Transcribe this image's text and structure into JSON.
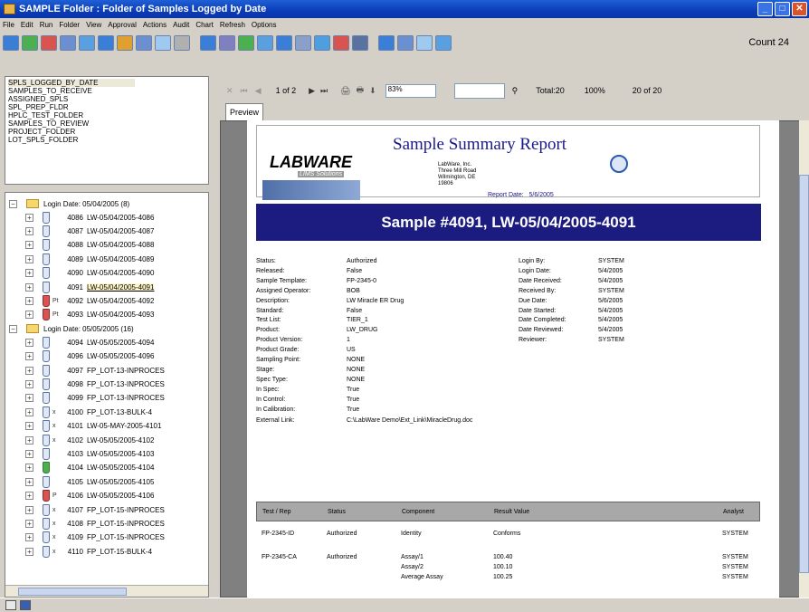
{
  "window": {
    "title": "SAMPLE Folder : Folder of Samples Logged by Date",
    "min": "_",
    "max": "□",
    "close": "✕"
  },
  "menu": [
    "File",
    "Edit",
    "Run",
    "Folder",
    "View",
    "Approval",
    "Actions",
    "Audit",
    "Chart",
    "Refresh",
    "Options"
  ],
  "toolbar": {
    "count": "Count 24",
    "icon_colors": [
      "#3a7fd5",
      "#4caf50",
      "#d9534f",
      "#6b8fcf",
      "#5aa0e0",
      "#3a7fd5",
      "#e0a030",
      "#6b8fcf",
      "#9fc9ef",
      "#b0b0b0",
      "#3a7fd5",
      "#8080c0",
      "#4caf50",
      "#5aa0e0",
      "#3a7fd5",
      "#8aa0c8",
      "#4f9fe0",
      "#d9534f",
      "#5a72a0",
      "#3a7fd5",
      "#6b8fcf",
      "#9fc9ef",
      "#5aa0e0"
    ]
  },
  "views": [
    "SPLS_LOGGED_BY_DATE",
    "SAMPLES_TO_RECEIVE",
    "ASSIGNED_SPLS",
    "SPL_PREP_FLDR",
    "HPLC_TEST_FOLDER",
    "SAMPLES_TO_REVIEW",
    "PROJECT_FOLDER",
    "LOT_SPLS_FOLDER"
  ],
  "tree": {
    "group1": "Login Date: 05/04/2005 (8)",
    "group2": "Login Date: 05/05/2005 (16)",
    "items1": [
      {
        "id": "4086",
        "label": "LW-05/04/2005-4086"
      },
      {
        "id": "4087",
        "label": "LW-05/04/2005-4087"
      },
      {
        "id": "4088",
        "label": "LW-05/04/2005-4088"
      },
      {
        "id": "4089",
        "label": "LW-05/04/2005-4089"
      },
      {
        "id": "4090",
        "label": "LW-05/04/2005-4090"
      },
      {
        "id": "4091",
        "label": "LW-05/04/2005-4091"
      },
      {
        "id": "4092",
        "label": "LW-05/04/2005-4092"
      },
      {
        "id": "4093",
        "label": "LW-05/04/2005-4093"
      }
    ],
    "items2": [
      {
        "id": "4094",
        "label": "LW-05/05/2005-4094"
      },
      {
        "id": "4096",
        "label": "LW-05/05/2005-4096"
      },
      {
        "id": "4097",
        "label": "FP_LOT-13-INPROCES"
      },
      {
        "id": "4098",
        "label": "FP_LOT-13-INPROCES"
      },
      {
        "id": "4099",
        "label": "FP_LOT-13-INPROCES"
      },
      {
        "id": "4100",
        "label": "FP_LOT-13-BULK-4"
      },
      {
        "id": "4101",
        "label": "LW-05-MAY-2005-4101"
      },
      {
        "id": "4102",
        "label": "LW-05/05/2005-4102"
      },
      {
        "id": "4103",
        "label": "LW-05/05/2005-4103"
      },
      {
        "id": "4104",
        "label": "LW-05/05/2005-4104"
      },
      {
        "id": "4105",
        "label": "LW-05/05/2005-4105"
      },
      {
        "id": "4106",
        "label": "LW-05/05/2005-4106"
      },
      {
        "id": "4107",
        "label": "FP_LOT-15-INPROCES"
      },
      {
        "id": "4108",
        "label": "FP_LOT-15-INPROCES"
      },
      {
        "id": "4109",
        "label": "FP_LOT-15-INPROCES"
      },
      {
        "id": "4110",
        "label": "FP_LOT-15-BULK-4"
      }
    ]
  },
  "reportnav": {
    "close": "✕",
    "first": "⏮",
    "prev": "◀",
    "page": "1 of 2",
    "next": "▶",
    "last": "⏭",
    "zoom": "83%",
    "total": "Total:20",
    "pct": "100%",
    "of": "20 of 20"
  },
  "tab": "Preview",
  "report": {
    "title": "Sample Summary Report",
    "logo": "LABWARE",
    "logo_sub": "LIMS Solutions",
    "address": [
      "LabWare, Inc.",
      "Three Mill Road",
      "Wilmington, DE",
      "19806"
    ],
    "report_date_label": "Report Date:",
    "report_date": "5/6/2005",
    "banner": "Sample #4091, LW-05/04/2005-4091",
    "left_fields": [
      [
        "Status:",
        "Authorized"
      ],
      [
        "Released:",
        "False"
      ],
      [
        "Sample Template:",
        "FP-2345-0"
      ],
      [
        "Assigned Operator:",
        "BOB"
      ],
      [
        "Description:",
        "LW Miracle ER Drug"
      ],
      [
        "Standard:",
        "False"
      ],
      [
        "Test List:",
        "TIER_1"
      ],
      [
        "Product:",
        "LW_DRUG"
      ],
      [
        "Product Version:",
        "1"
      ],
      [
        "Product Grade:",
        "US"
      ],
      [
        "Sampling Point:",
        "NONE"
      ],
      [
        "Stage:",
        "NONE"
      ],
      [
        "Spec Type:",
        "NONE"
      ],
      [
        "In Spec:",
        "True"
      ],
      [
        "In Control:",
        "True"
      ],
      [
        "In Calibration:",
        "True"
      ]
    ],
    "ext_link_label": "External Link:",
    "ext_link": "C:\\LabWare Demo\\Ext_Link\\MiracleDrug.doc",
    "right_fields": [
      [
        "Login By:",
        "SYSTEM"
      ],
      [
        "Login Date:",
        "5/4/2005"
      ],
      [
        "Date Received:",
        "5/4/2005"
      ],
      [
        "Received By:",
        "SYSTEM"
      ],
      [
        "Due Date:",
        "5/6/2005"
      ],
      [
        "Date Started:",
        "5/4/2005"
      ],
      [
        "Date Completed:",
        "5/4/2005"
      ],
      [
        "Date Reviewed:",
        "5/4/2005"
      ],
      [
        "Reviewer:",
        "SYSTEM"
      ]
    ],
    "table_header": [
      "Test / Rep",
      "Status",
      "Component",
      "Result Value",
      "Analyst"
    ],
    "rows": [
      [
        "FP-2345-ID",
        "Authorized",
        "Identity",
        "Conforms",
        "SYSTEM"
      ],
      [
        "FP-2345-CA",
        "Authorized",
        "Assay/1",
        "100.40",
        "SYSTEM"
      ],
      [
        "",
        "",
        "Assay/2",
        "100.10",
        "SYSTEM"
      ],
      [
        "",
        "",
        "Average Assay",
        "100.25",
        "SYSTEM"
      ]
    ]
  }
}
